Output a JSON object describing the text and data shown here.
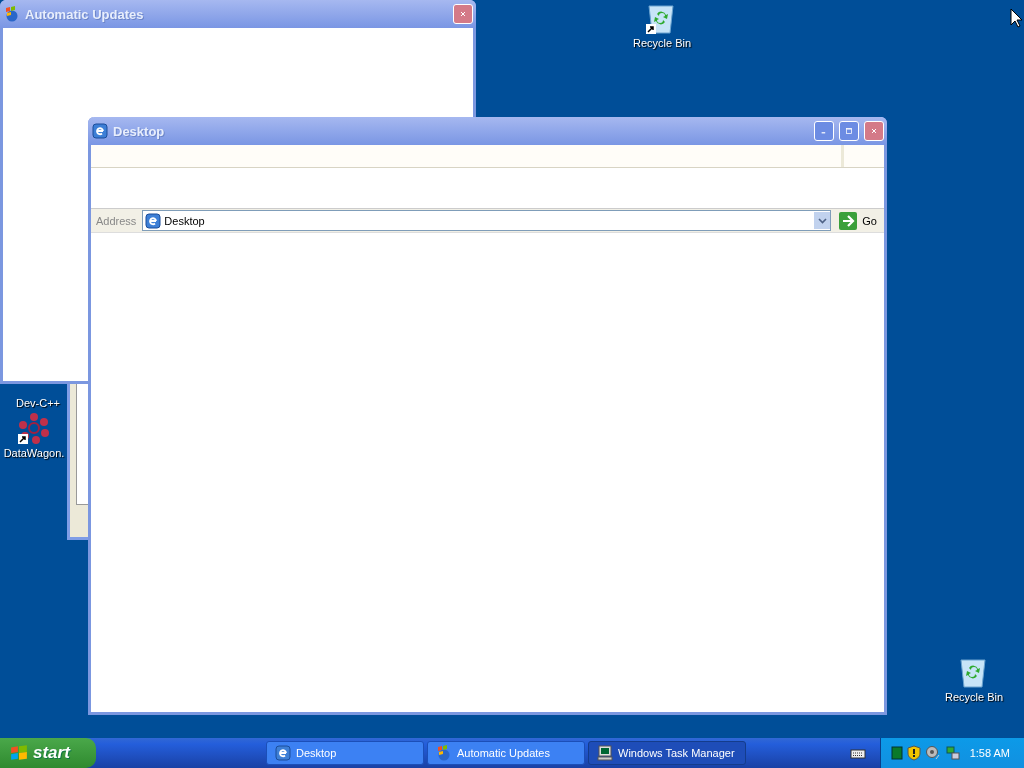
{
  "desktop_icons": [
    {
      "kind": "recycle-bin",
      "label": "Recycle Bin",
      "shortcut": true
    },
    {
      "kind": "code",
      "label": "Dev-C++",
      "shortcut": false
    },
    {
      "kind": "molecule",
      "label": "DataWagon.",
      "shortcut": true
    },
    {
      "kind": "recycle-bin",
      "label": "Recycle Bin",
      "shortcut": false
    }
  ],
  "windows": [
    {
      "title": "Automatic Updates"
    },
    {
      "title": "Desktop",
      "address_label": "Address",
      "address": "Desktop",
      "go": "Go"
    }
  ],
  "taskbar": {
    "start": "start",
    "buttons": [
      {
        "kind": "browser",
        "label": "Desktop",
        "selected": false
      },
      {
        "kind": "updates",
        "label": "Automatic Updates",
        "selected": false
      },
      {
        "kind": "monitor",
        "label": "Windows Task Manager",
        "selected": true
      }
    ],
    "clock": "1:58 AM"
  }
}
